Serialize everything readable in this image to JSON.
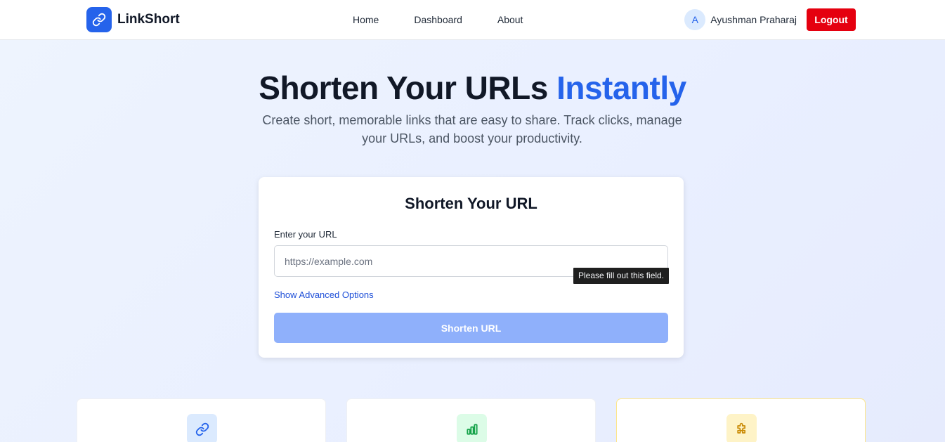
{
  "app": {
    "name": "LinkShort"
  },
  "nav": {
    "home": "Home",
    "dashboard": "Dashboard",
    "about": "About"
  },
  "user": {
    "initial": "A",
    "name": "Ayushman Praharaj",
    "logout_label": "Logout"
  },
  "hero": {
    "title_main": "Shorten Your URLs ",
    "title_accent": "Instantly",
    "subtitle": "Create short, memorable links that are easy to share. Track clicks, manage your URLs, and boost your productivity."
  },
  "form": {
    "title": "Shorten Your URL",
    "label": "Enter your URL",
    "placeholder": "https://example.com",
    "value": "",
    "validation_tooltip": "Please fill out this field.",
    "advanced_link": "Show Advanced Options",
    "submit_label": "Shorten URL"
  },
  "features": [
    {
      "icon": "link-icon"
    },
    {
      "icon": "bar-chart-icon"
    },
    {
      "icon": "puzzle-icon"
    }
  ],
  "colors": {
    "brand": "#2563eb",
    "logout": "#e5000f",
    "submit_disabled": "#8fb0fb",
    "feature_link_bg": "#dbeafe",
    "feature_chart_bg": "#dcfce7",
    "feature_puzzle_bg": "#fef3c7"
  }
}
